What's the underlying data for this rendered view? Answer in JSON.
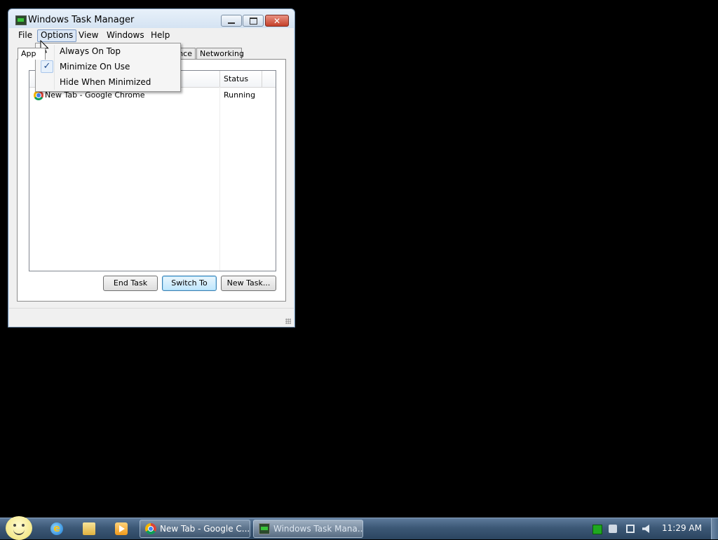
{
  "window": {
    "title": "Windows Task Manager",
    "close_glyph": "✕"
  },
  "menubar": {
    "items": [
      "File",
      "Options",
      "View",
      "Windows",
      "Help"
    ]
  },
  "tabs": [
    {
      "label": "App"
    },
    {
      "label": "nce"
    },
    {
      "label": "Networking"
    }
  ],
  "listview": {
    "columns": {
      "status": "Status"
    },
    "rows": [
      {
        "task": "New Tab - Google Chrome",
        "status": "Running",
        "icon": "chrome-icon"
      }
    ]
  },
  "buttons": {
    "end_task": "End Task",
    "switch_to": "Switch To",
    "new_task": "New Task..."
  },
  "options_menu": {
    "items": [
      {
        "label": "Always On Top",
        "checked": false
      },
      {
        "label": "Minimize On Use",
        "checked": true
      },
      {
        "label": "Hide When Minimized",
        "checked": false
      }
    ],
    "check_glyph": "✓"
  },
  "taskbar": {
    "ie_glyph": "e",
    "buttons": [
      {
        "label": "New Tab - Google C...",
        "icon": "chrome-icon"
      },
      {
        "label": "Windows Task Mana...",
        "icon": "task-manager-icon"
      }
    ],
    "clock": "11:29 AM"
  }
}
